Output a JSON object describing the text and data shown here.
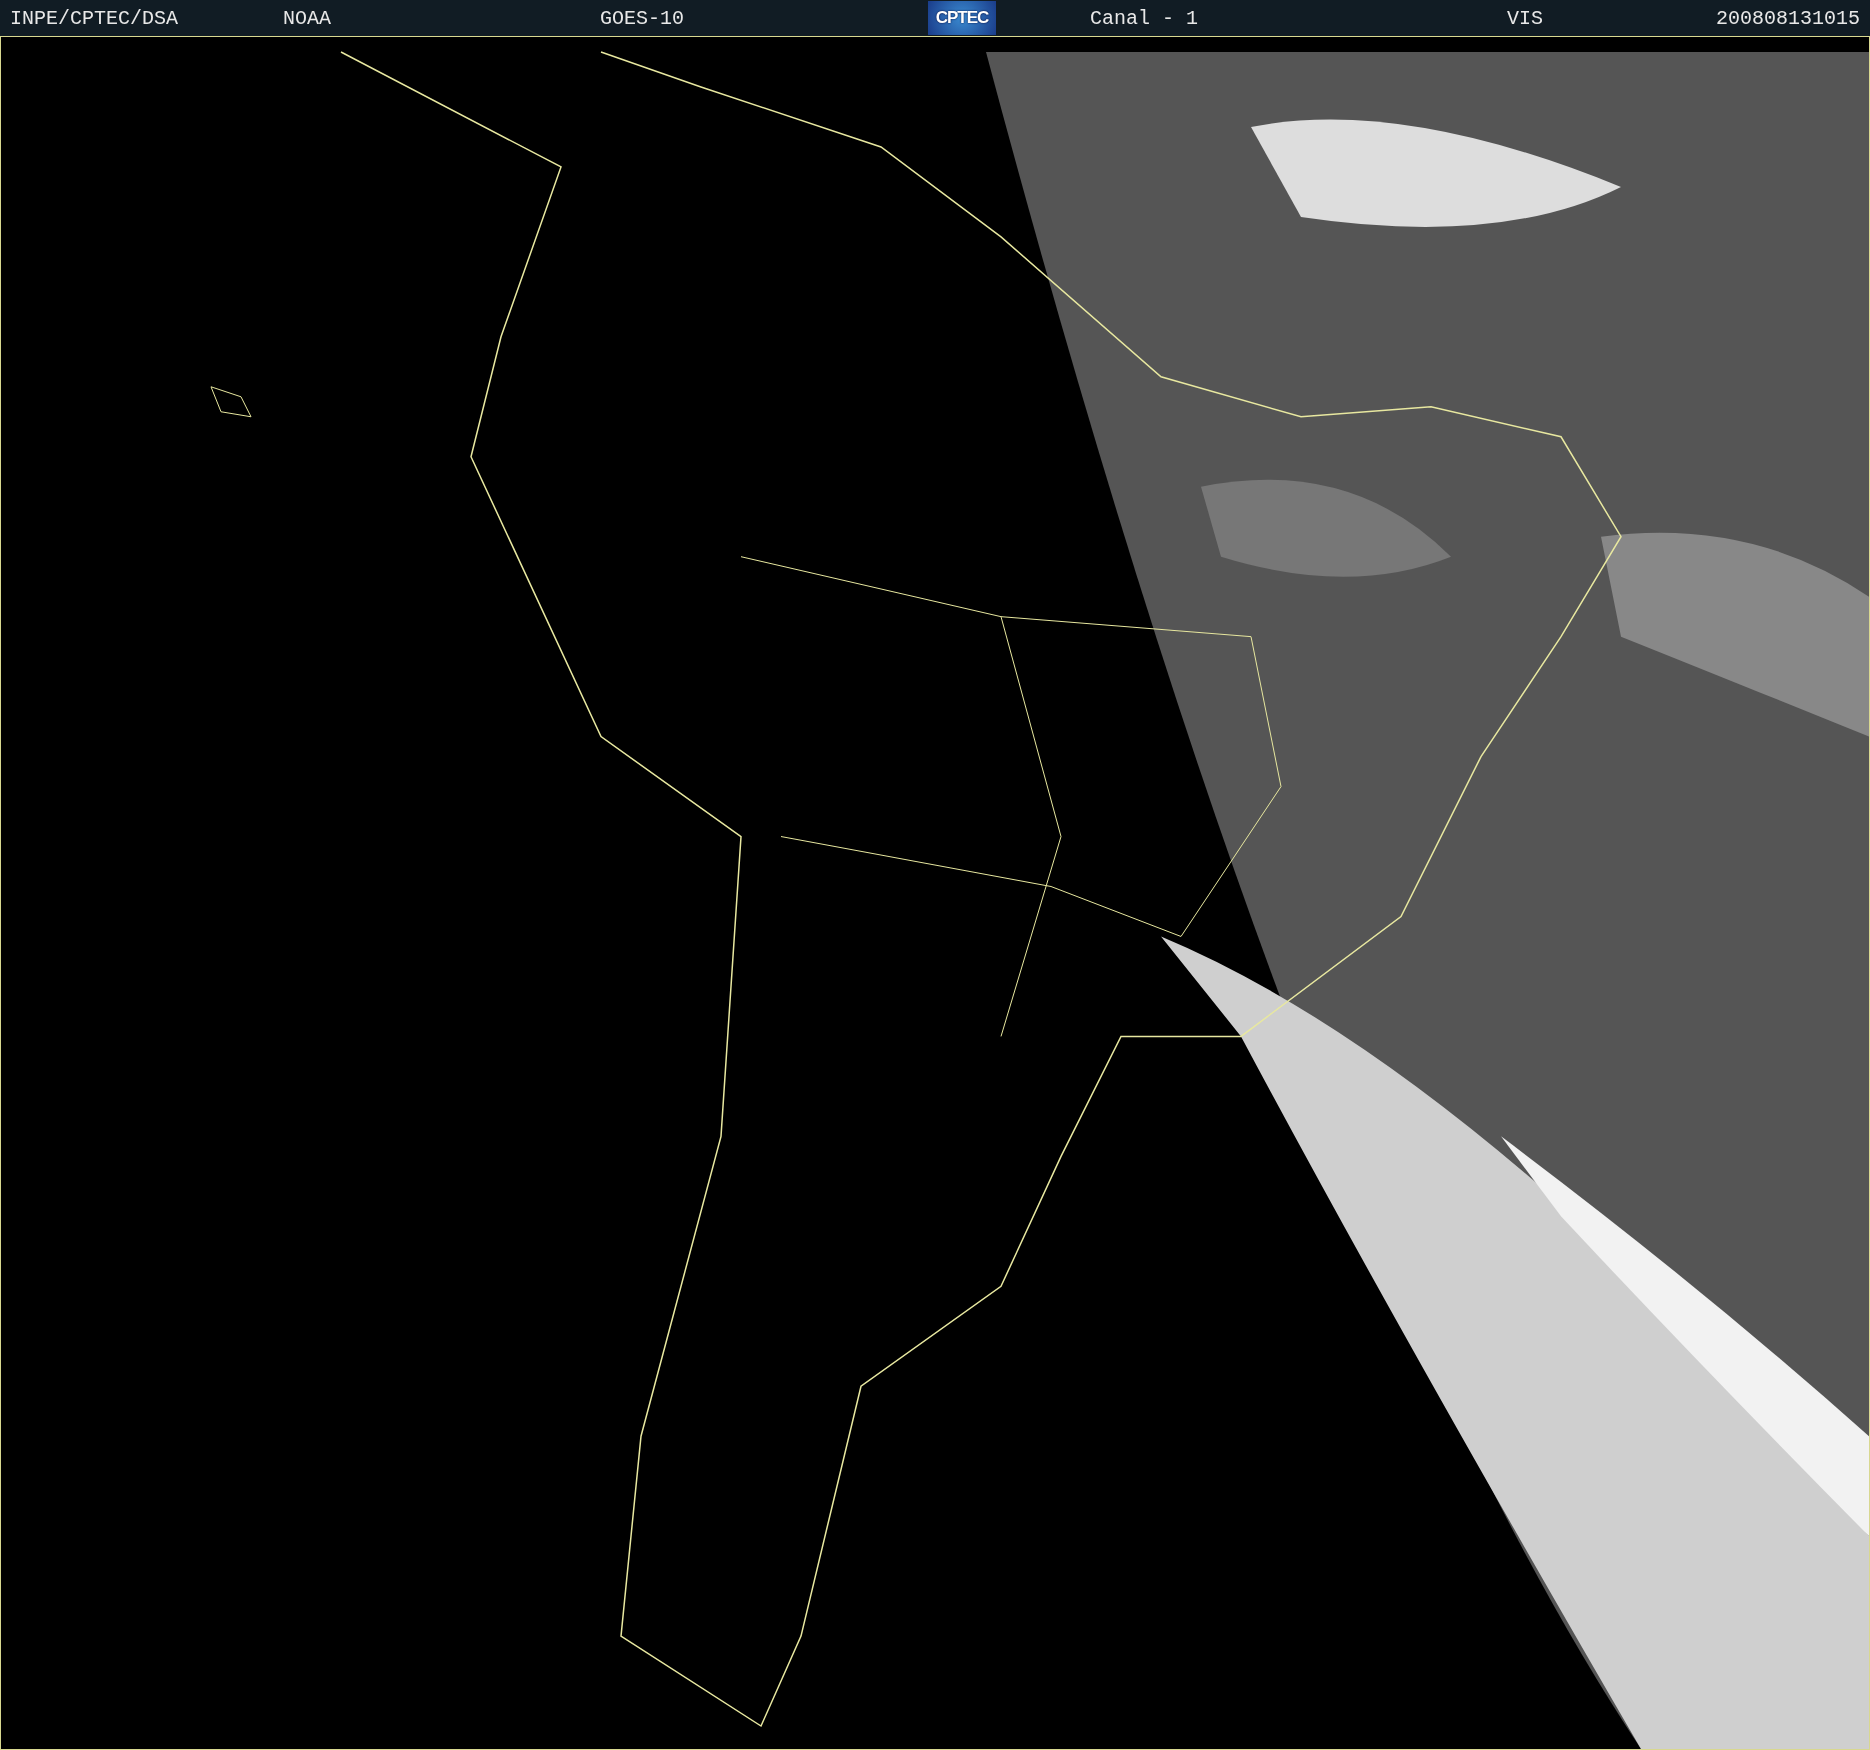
{
  "header": {
    "source": "INPE/CPTEC/DSA",
    "agency": "NOAA",
    "satellite": "GOES-10",
    "logo": "CPTEC",
    "channel": "Canal - 1",
    "band": "VIS",
    "timestamp": "200808131015"
  }
}
